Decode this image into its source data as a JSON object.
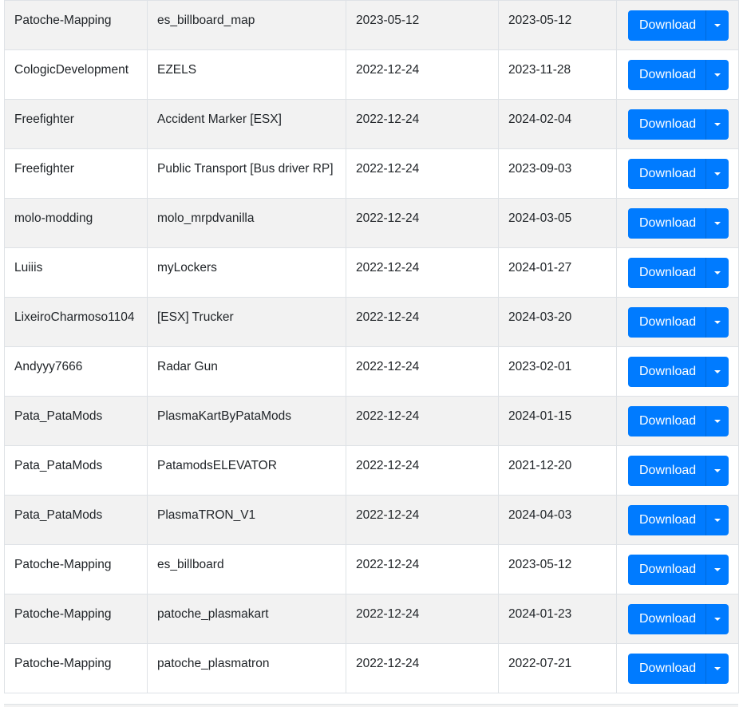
{
  "table": {
    "action_label": "Download",
    "rows": [
      {
        "author": "Patoche-Mapping",
        "name": "es_billboard_map",
        "created": "2023-05-12",
        "updated": "2023-05-12"
      },
      {
        "author": "CologicDevelopment",
        "name": "EZELS",
        "created": "2022-12-24",
        "updated": "2023-11-28"
      },
      {
        "author": "Freefighter",
        "name": "Accident Marker [ESX]",
        "created": "2022-12-24",
        "updated": "2024-02-04"
      },
      {
        "author": "Freefighter",
        "name": "Public Transport [Bus driver RP]",
        "created": "2022-12-24",
        "updated": "2023-09-03"
      },
      {
        "author": "molo-modding",
        "name": "molo_mrpdvanilla",
        "created": "2022-12-24",
        "updated": "2024-03-05"
      },
      {
        "author": "Luiiis",
        "name": "myLockers",
        "created": "2022-12-24",
        "updated": "2024-01-27"
      },
      {
        "author": "LixeiroCharmoso1104",
        "name": "[ESX] Trucker",
        "created": "2022-12-24",
        "updated": "2024-03-20"
      },
      {
        "author": "Andyyy7666",
        "name": "Radar Gun",
        "created": "2022-12-24",
        "updated": "2023-02-01"
      },
      {
        "author": "Pata_PataMods",
        "name": "PlasmaKartByPataMods",
        "created": "2022-12-24",
        "updated": "2024-01-15"
      },
      {
        "author": "Pata_PataMods",
        "name": "PatamodsELEVATOR",
        "created": "2022-12-24",
        "updated": "2021-12-20"
      },
      {
        "author": "Pata_PataMods",
        "name": "PlasmaTRON_V1",
        "created": "2022-12-24",
        "updated": "2024-04-03"
      },
      {
        "author": "Patoche-Mapping",
        "name": "es_billboard",
        "created": "2022-12-24",
        "updated": "2023-05-12"
      },
      {
        "author": "Patoche-Mapping",
        "name": "patoche_plasmakart",
        "created": "2022-12-24",
        "updated": "2024-01-23"
      },
      {
        "author": "Patoche-Mapping",
        "name": "patoche_plasmatron",
        "created": "2022-12-24",
        "updated": "2022-07-21"
      }
    ]
  },
  "colors": {
    "button": "#007bff",
    "stripe": "#f2f2f2",
    "border": "#dee2e6"
  },
  "icons": {
    "toggle": "caret-down-icon"
  }
}
